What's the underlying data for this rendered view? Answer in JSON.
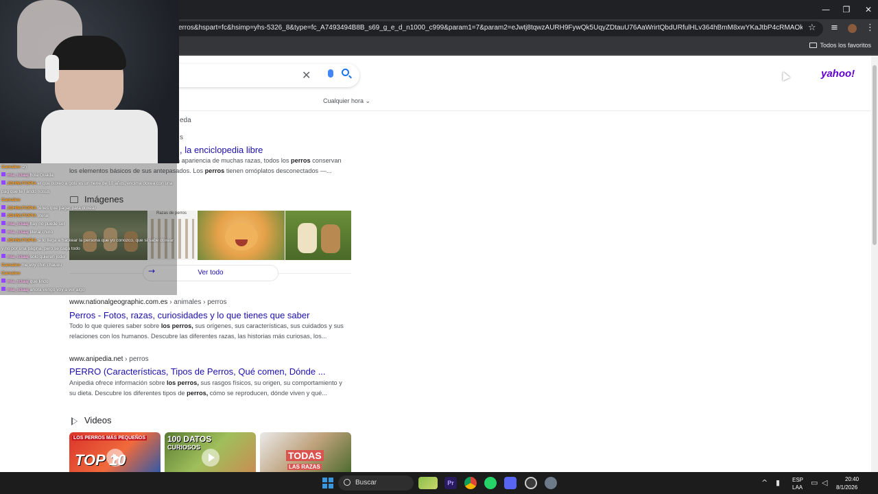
{
  "browser": {
    "url": "erros&hspart=fc&hsimp=yhs-5326_8&type=fc_A7493494B8B_s69_g_e_d_n1000_c999&param1=7&param2=eJwtj8tqwzAURH9FywQk5UqyZDtauU76AaWrirtQbdURfulHLv364hBmM8xwYKaJtbP4cRMAOk2Mozg4iwlAHMW...",
    "bookmarks_label": "Todos los favoritos",
    "window_controls": [
      "—",
      "❐",
      "✕"
    ]
  },
  "search": {
    "time_filter": "Cualquier hora",
    "logo": "yahoo!"
  },
  "results": [
    {
      "partial_source": "eda",
      "partial_sub": "s",
      "title_partial": ", la enciclopedia libre",
      "snippet_line1_prefix": "",
      "snippet_line1": "a apariencia de muchas razas, todos los ",
      "snippet_line1_bold": "perros",
      "snippet_line1_suffix": " conservan",
      "snippet_line2_prefix": "los elementos básicos de sus antepasados. Los ",
      "snippet_line2_bold": "perros",
      "snippet_line2_suffix": " tienen omóplatos desconectados —..."
    },
    {
      "domain": "www.nationalgeographic.com.es",
      "path": " › animales › perros",
      "title": "Perros - Fotos, razas, curiosidades y lo que tienes que saber",
      "snippet_a": "Todo lo que quieres saber sobre ",
      "snippet_b": "los perros,",
      "snippet_c": " sus orígenes, sus características, sus cuidados y sus",
      "snippet_d": "relaciones con los humanos. Descubre las diferentes razas, las historias más curiosas, los..."
    },
    {
      "domain": "www.anipedia.net",
      "path": " › perros",
      "title": "PERRO (Características, Tipos de Perros, Qué comen, Dónde ...",
      "snippet_a": "Anipedia ofrece información sobre ",
      "snippet_b": "los perros,",
      "snippet_c": " sus rasgos físicos, su origen, su comportamiento y",
      "snippet_d": "su dieta. Descubre los diferentes tipos de ",
      "snippet_e": "perros,",
      "snippet_f": " cómo se reproducen, dónde viven y qué..."
    }
  ],
  "images_section": {
    "label": "Imágenes",
    "thumb2_caption": "Razas de perros",
    "ver_todo": "Ver todo"
  },
  "videos_section": {
    "label": "Videos",
    "thumbs": [
      {
        "caption_top": "LOS PERROS MÁS PEQUEÑOS",
        "caption_main": "TOP 10"
      },
      {
        "caption_top": "100 DATOS",
        "caption_main": "CURIOSOS"
      },
      {
        "caption_top": "TODAS",
        "caption_main": "LAS RAZAS"
      }
    ]
  },
  "chat": [
    {
      "user": "Camaleo",
      "msg": ":2)",
      "orange": true
    },
    {
      "user": "mia_tclaaj",
      "msg": "hola Guada",
      "orange": false
    },
    {
      "user": "JOHNUTOPIA",
      "msg": "el que doxeo a golu es un nene de 10 años, encima doxea con una",
      "orange": true
    },
    {
      "user": "",
      "msg": "pag que te l ando nosus",
      "orange": false
    },
    {
      "user": "Camaleo",
      "msg": "",
      "orange": true
    },
    {
      "user": "JOHNUTOPIA",
      "msg": "tenes que pagar para doxear",
      "orange": true
    },
    {
      "user": "JOHNUTOPIA",
      "msg": "literal",
      "orange": true
    },
    {
      "user": "mia_tclaaj",
      "msg": "hay no puede ser",
      "orange": false
    },
    {
      "user": "mia_tclaaj",
      "msg": "literal chino",
      "orange": false
    },
    {
      "user": "JOHNUTOPIA",
      "msg": "si lo llega a hackear la persona que yo conozco, que si sabe doxear",
      "orange": true
    },
    {
      "user": "",
      "msg": "y no por una página, pero se caga todo",
      "orange": false
    },
    {
      "user": "mia_tclaaj",
      "msg": "solo quieren joder",
      "orange": false
    },
    {
      "user": "Camaleo",
      "msg": "me voy chiri chauuu",
      "orange": true
    },
    {
      "user": "Camaleo",
      "msg": "",
      "orange": true
    },
    {
      "user": "mia_tclaaj",
      "msg": "que lindo",
      "orange": false
    },
    {
      "user": "mia_tclaaj",
      "msg": "ahora vengo voy a ver algo",
      "orange": false
    }
  ],
  "taskbar": {
    "search_label": "Buscar",
    "lang1": "ESP",
    "lang2": "LAA",
    "time": "20:40",
    "date": "8/1/2026"
  },
  "colors": {
    "link": "#1a0dab",
    "yahoo": "#6001d2",
    "chrome_dark": "#202124"
  }
}
